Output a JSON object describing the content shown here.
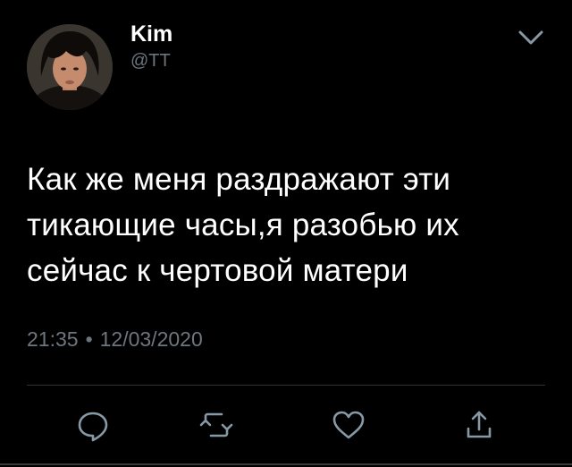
{
  "author": {
    "name": "Kim",
    "handle": "@TT"
  },
  "tweet": {
    "text": "Как же меня раздражают эти\nтикающие часы,я разобью их\nсейчас к чертовой матери",
    "time": "21:35",
    "separator": "•",
    "date": "12/03/2020"
  },
  "icons": {
    "menu": "chevron-down-icon",
    "reply": "reply-icon",
    "retweet": "retweet-icon",
    "like": "heart-icon",
    "share": "share-icon"
  },
  "colors": {
    "background": "#000000",
    "text": "#ffffff",
    "secondary_text": "#6e767d",
    "icon": "#8899a6",
    "divider": "#2f3336"
  }
}
